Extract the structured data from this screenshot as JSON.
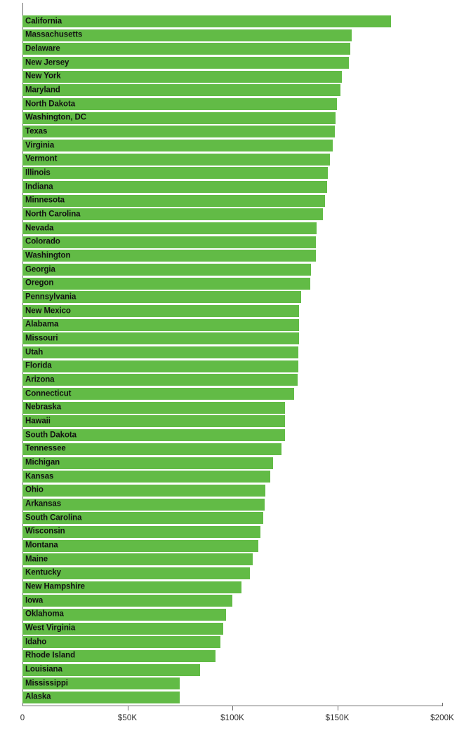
{
  "chart_data": {
    "type": "bar",
    "orientation": "horizontal",
    "title": "",
    "subtitle": "",
    "xlabel": "",
    "ylabel": "",
    "xlim": [
      0,
      200000
    ],
    "grid": false,
    "legend": null,
    "bar_color": "#62bb46",
    "label_color": "#111111",
    "axis_color": "#6d6d6d",
    "background": "#ffffff",
    "value_prefix": "$",
    "value_unit": "K",
    "axis_ticks": [
      {
        "value": 0,
        "label": "0"
      },
      {
        "value": 50000,
        "label": "$50K"
      },
      {
        "value": 100000,
        "label": "$100K"
      },
      {
        "value": 150000,
        "label": "$150K"
      },
      {
        "value": 200000,
        "label": "$200K"
      }
    ],
    "categories": [
      "California",
      "Massachusetts",
      "Delaware",
      "New Jersey",
      "New York",
      "Maryland",
      "North Dakota",
      "Washington, DC",
      "Texas",
      "Virginia",
      "Vermont",
      "Illinois",
      "Indiana",
      "Minnesota",
      "North Carolina",
      "Nevada",
      "Colorado",
      "Washington",
      "Georgia",
      "Oregon",
      "Pennsylvania",
      "New Mexico",
      "Alabama",
      "Missouri",
      "Utah",
      "Florida",
      "Arizona",
      "Connecticut",
      "Nebraska",
      "Hawaii",
      "South Dakota",
      "Tennessee",
      "Michigan",
      "Kansas",
      "Ohio",
      "Arkansas",
      "South Carolina",
      "Wisconsin",
      "Montana",
      "Maine",
      "Kentucky",
      "New Hampshire",
      "Iowa",
      "Oklahoma",
      "West Virginia",
      "Idaho",
      "Rhode Island",
      "Louisiana",
      "Mississippi",
      "Alaska"
    ],
    "values": [
      175600,
      156900,
      156200,
      155500,
      152200,
      151500,
      149800,
      149200,
      148800,
      147800,
      146500,
      145500,
      145100,
      144100,
      143100,
      140100,
      139800,
      139800,
      137400,
      137100,
      132800,
      131800,
      131800,
      131800,
      131400,
      131400,
      131100,
      129400,
      125100,
      125100,
      125100,
      123400,
      119400,
      118100,
      115700,
      115400,
      114700,
      113400,
      112400,
      109700,
      108400,
      104400,
      100000,
      96900,
      95700,
      94300,
      92000,
      84600,
      74900,
      74900
    ]
  }
}
